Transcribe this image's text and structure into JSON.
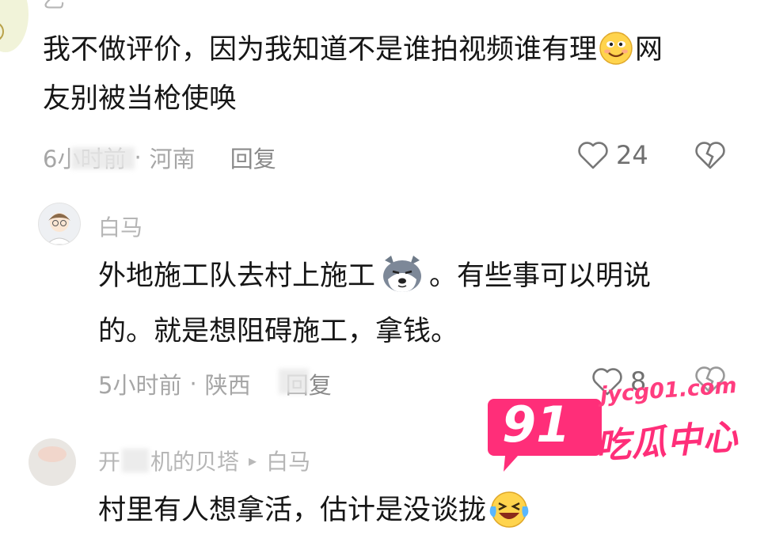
{
  "comments": [
    {
      "username": "乙",
      "text_line1_a": "我不做评价，因为我知道不是谁拍视频谁有理",
      "text_line1_b": "网",
      "text_line2": "友别被当枪使唤",
      "emoji": "smile-emoji",
      "time": "6小时前",
      "location": "河南",
      "reply_label": "回复",
      "likes": "24"
    },
    {
      "username": "白马",
      "text_line1_a": "外地施工队去村上施工",
      "text_line1_b": "。有些事可以明说",
      "text_line2": "的。就是想阻碍施工，拿钱。",
      "emoji": "husky-dog-emoji",
      "time": "5小时前",
      "location": "陕西",
      "reply_label": "回复",
      "likes": "8"
    },
    {
      "username": "开",
      "username_rest": "机的贝塔",
      "reply_to": "白马",
      "text_line1_a": "村里有人想拿活，估计是没谈拢",
      "emoji": "laughing-crying-emoji"
    }
  ],
  "separator": "·",
  "reply_arrow": "▸",
  "watermark": {
    "badge_number": "91",
    "url": "jycg01.com",
    "name": "吃瓜中心",
    "color": "#ff2e79"
  }
}
